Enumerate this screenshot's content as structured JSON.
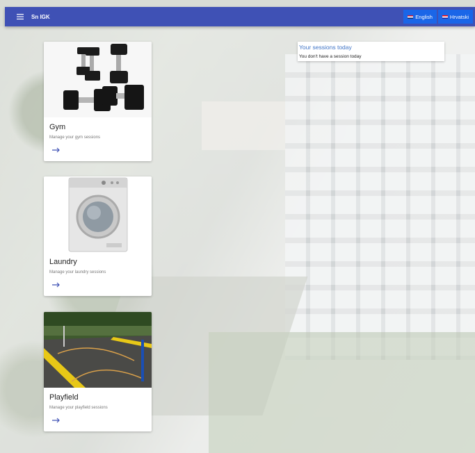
{
  "appbar": {
    "title": "Sn IGK",
    "languages": [
      {
        "label": "English",
        "flag": "en"
      },
      {
        "label": "Hrvatski",
        "flag": "hr"
      }
    ]
  },
  "cards": [
    {
      "title": "Gym",
      "subtitle": "Manage your gym sessions",
      "arrow": "→"
    },
    {
      "title": "Laundry",
      "subtitle": "Manage your laundry sessions",
      "arrow": "→"
    },
    {
      "title": "Playfield",
      "subtitle": "Manage your playfield sessions",
      "arrow": "→"
    }
  ],
  "sessions": {
    "title": "Your sessions today",
    "message": "You don't have a session today"
  },
  "colors": {
    "appbar": "#3f51b5",
    "language_button": "#1a66e8",
    "accent": "#3f74c6"
  },
  "icons": {
    "menu": "menu-icon",
    "arrow": "arrow-right-icon"
  }
}
